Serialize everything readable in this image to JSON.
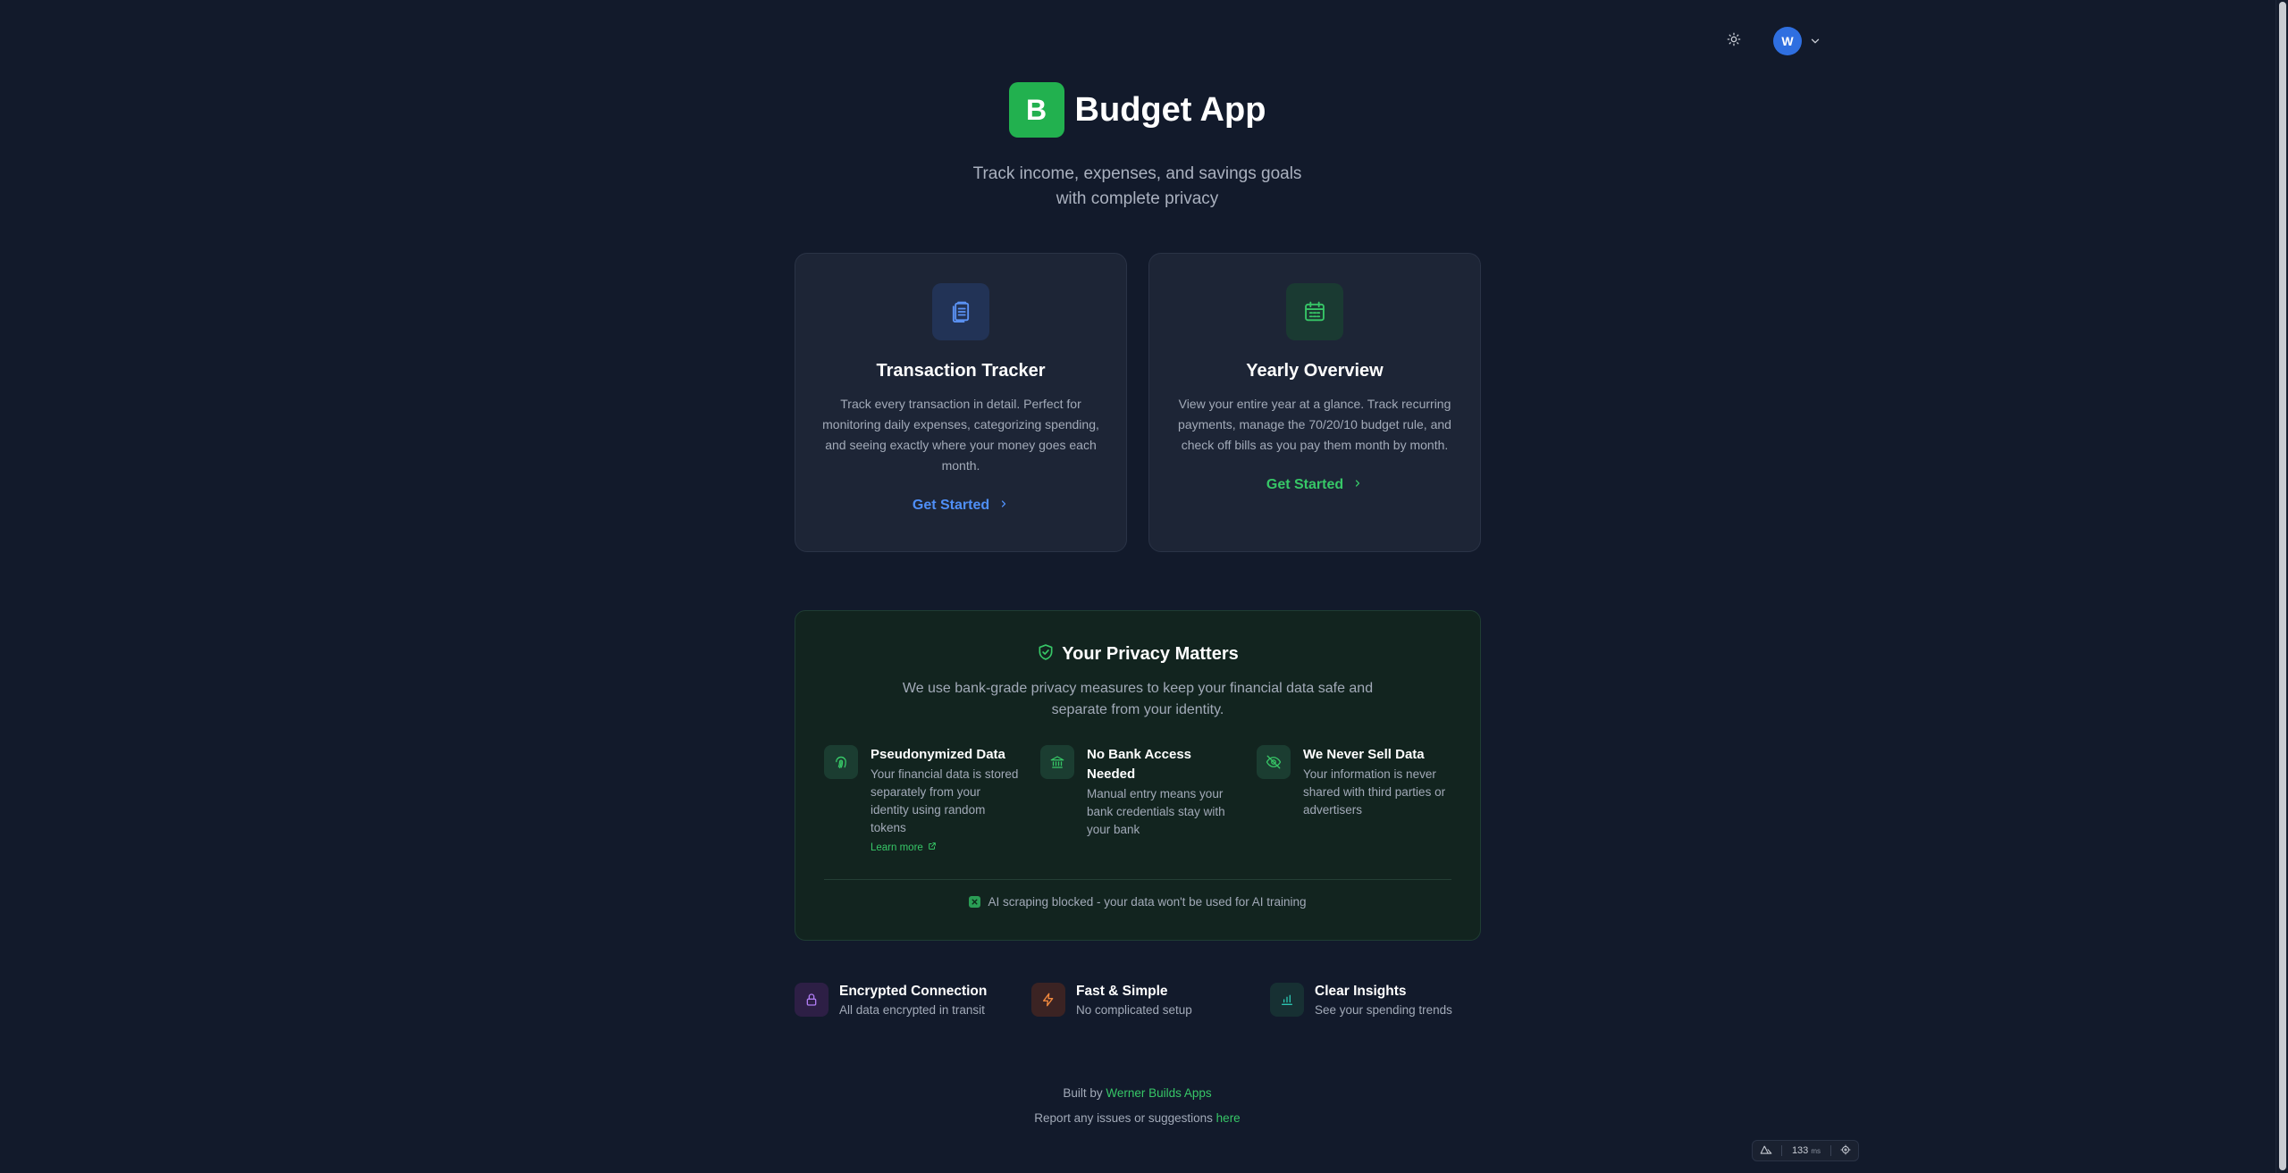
{
  "header": {
    "avatar_initial": "W",
    "brand_letter": "B",
    "title": "Budget App",
    "subtitle": "Track income, expenses, and savings goals with complete privacy"
  },
  "cards": [
    {
      "icon": "clipboard-list-icon",
      "title": "Transaction Tracker",
      "description": "Track every transaction in detail. Perfect for monitoring daily expenses, categorizing spending, and seeing exactly where your money goes each month.",
      "cta": "Get Started",
      "accent": "#4f8ff7"
    },
    {
      "icon": "calendar-icon",
      "title": "Yearly Overview",
      "description": "View your entire year at a glance. Track recurring payments, manage the 70/20/10 budget rule, and check off bills as you pay them month by month.",
      "cta": "Get Started",
      "accent": "#37c767"
    }
  ],
  "privacy": {
    "title": "Your Privacy Matters",
    "description": "We use bank-grade privacy measures to keep your financial data safe and separate from your identity.",
    "features": [
      {
        "icon": "fingerprint-icon",
        "title": "Pseudonymized Data",
        "description": "Your financial data is stored separately from your identity using random tokens",
        "link": "Learn more"
      },
      {
        "icon": "bank-icon",
        "title": "No Bank Access Needed",
        "description": "Manual entry means your bank credentials stay with your bank"
      },
      {
        "icon": "eye-off-icon",
        "title": "We Never Sell Data",
        "description": "Your information is never shared with third parties or advertisers"
      }
    ],
    "ai_note": "AI scraping blocked - your data won't be used for AI training"
  },
  "bottom_features": [
    {
      "icon": "lock-icon",
      "title": "Encrypted Connection",
      "description": "All data encrypted in transit"
    },
    {
      "icon": "lightning-icon",
      "title": "Fast & Simple",
      "description": "No complicated setup"
    },
    {
      "icon": "bar-chart-icon",
      "title": "Clear Insights",
      "description": "See your spending trends"
    }
  ],
  "footer": {
    "built_by_prefix": "Built by",
    "built_by_link": "Werner Builds Apps",
    "report_prefix": "Report any issues or suggestions",
    "report_link": "here"
  },
  "dev_badge": {
    "value": "133",
    "unit": "ms"
  },
  "colors": {
    "background": "#121a2b",
    "brand": "#22b14f",
    "blue_accent": "#4f8ff7",
    "green_accent": "#37c767"
  }
}
